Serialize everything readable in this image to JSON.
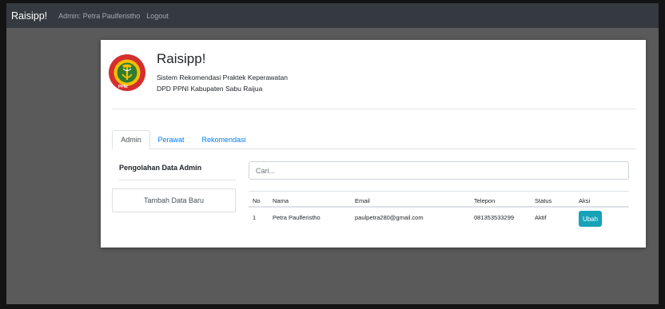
{
  "navbar": {
    "brand": "Raisipp!",
    "links": [
      "Admin: Petra Paulferistho",
      "Logout"
    ]
  },
  "header": {
    "title": "Raisipp!",
    "subtitle": "Sistem Rekomendasi Praktek Keperawatan",
    "organization": "DPD PPNI Kabupaten Sabu Raijua",
    "logo_text": "PPNI"
  },
  "tabs": [
    {
      "label": "Admin",
      "active": true
    },
    {
      "label": "Perawat",
      "active": false
    },
    {
      "label": "Rekomendasi",
      "active": false
    }
  ],
  "sidebar": {
    "title": "Pengolahan Data Admin",
    "add_button": "Tambah Data Baru"
  },
  "search": {
    "placeholder": "Cari..."
  },
  "table": {
    "headers": [
      "No",
      "Nama",
      "Email",
      "Telepon",
      "Status",
      "Aksi"
    ],
    "rows": [
      {
        "no": "1",
        "nama": "Petra Paulferistho",
        "email": "paulpetra280@gmail.com",
        "telepon": "081353533299",
        "status": "Aktif",
        "aksi": "Ubah"
      }
    ]
  },
  "colors": {
    "navbar_bg": "#343a40",
    "link": "#007bff",
    "edit_button": "#17a2b8",
    "page_bg": "#5a5a5a"
  }
}
